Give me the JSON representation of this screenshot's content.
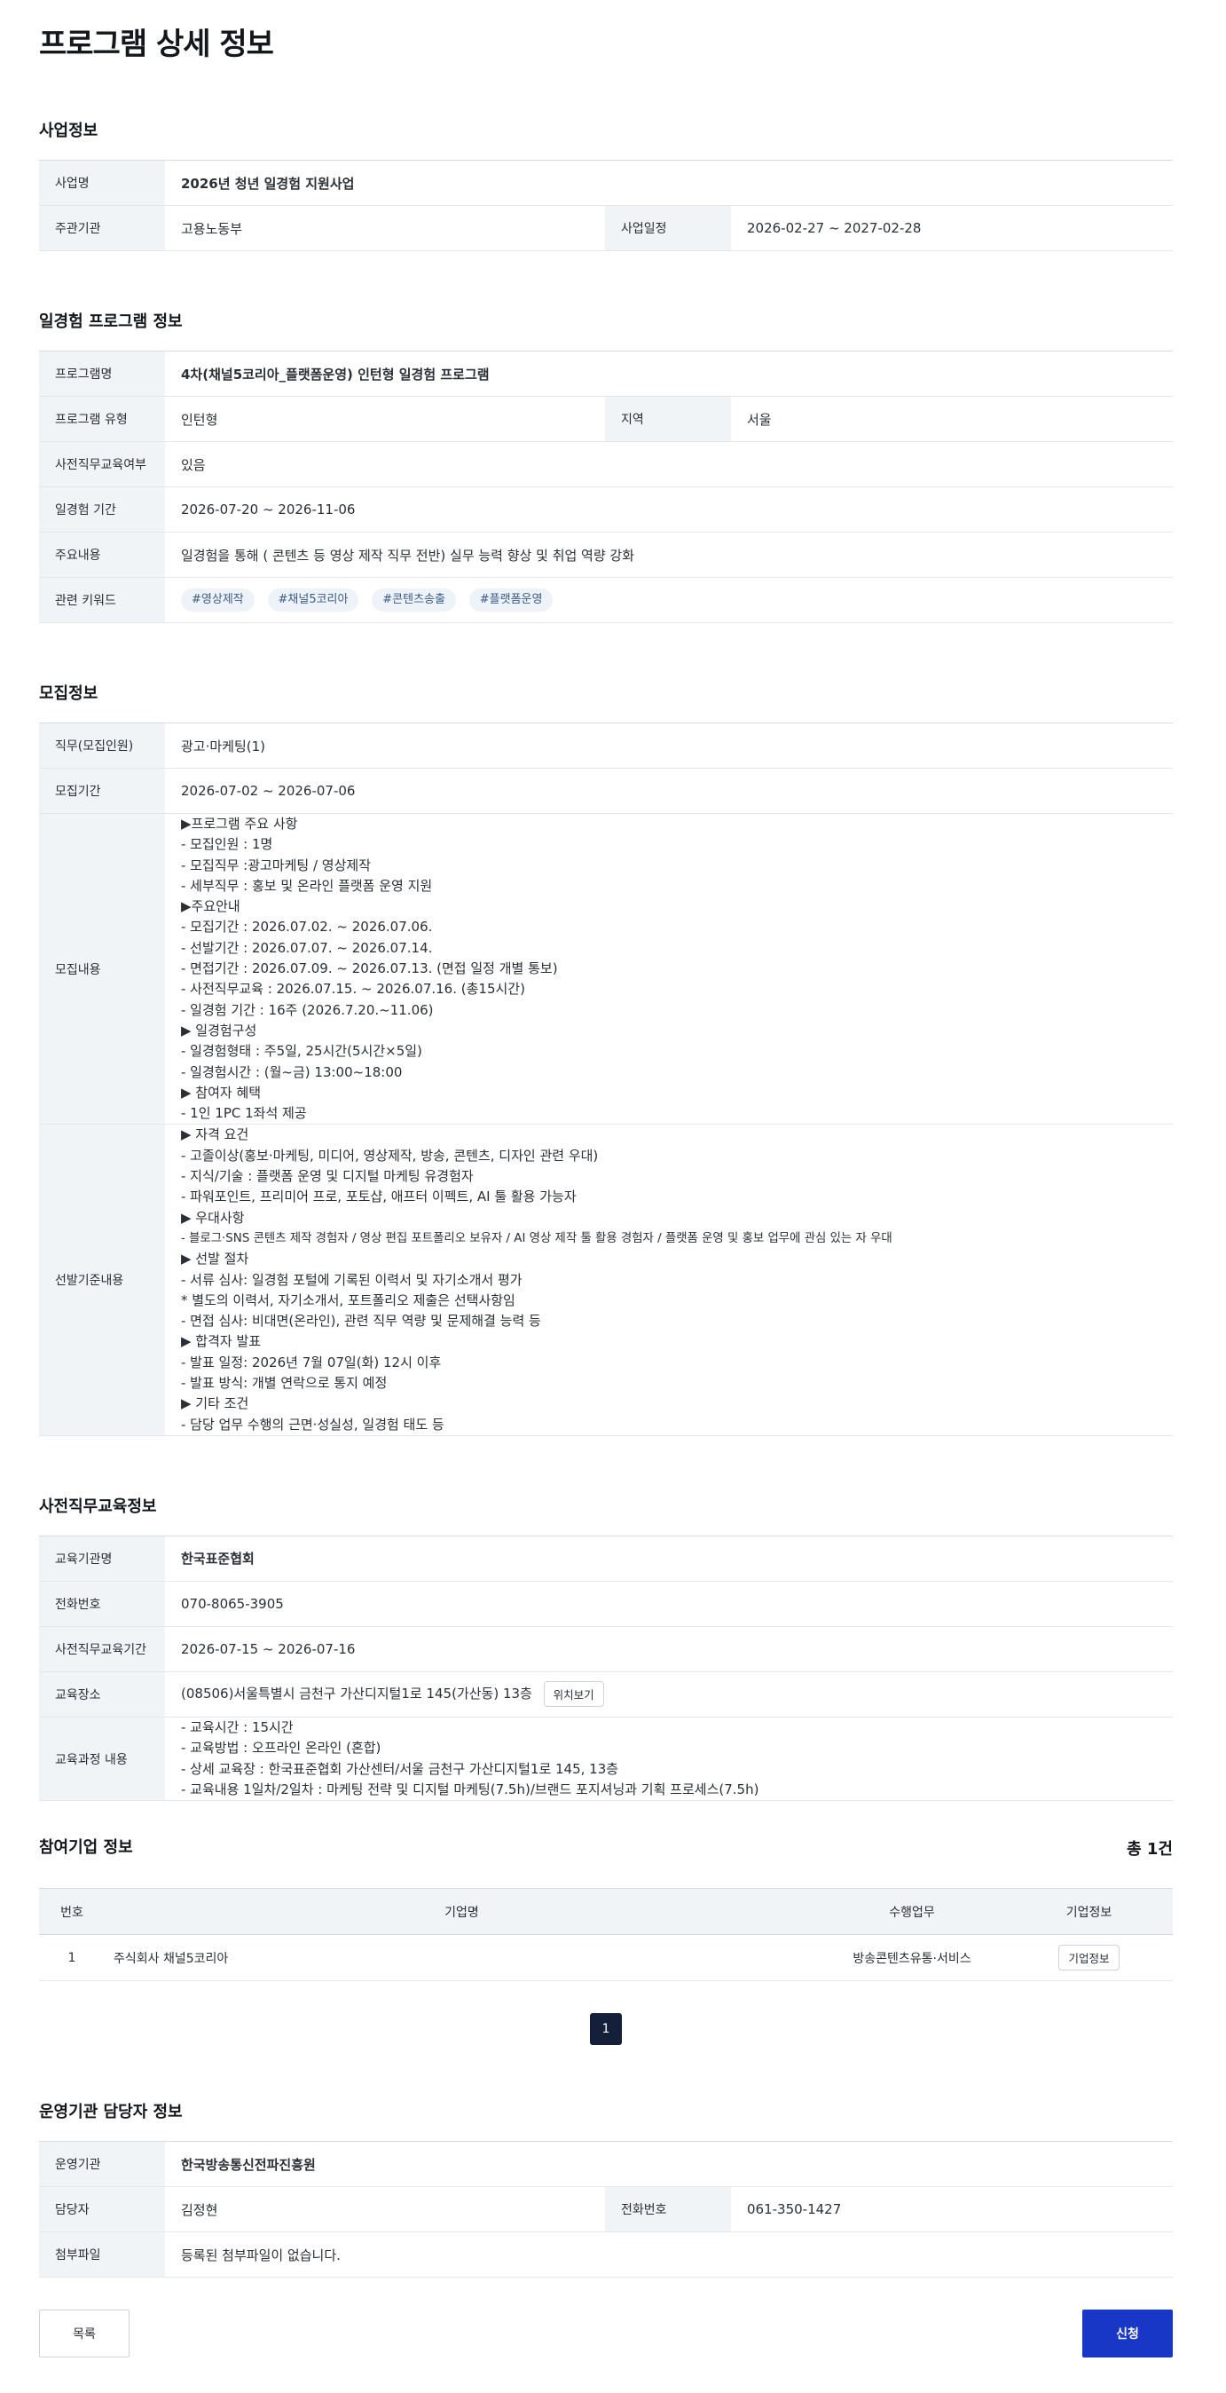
{
  "page_title": "프로그램 상세 정보",
  "business": {
    "title": "사업정보",
    "name_label": "사업명",
    "name": "2026년 청년 일경험 지원사업",
    "org_label": "주관기관",
    "org": "고용노동부",
    "period_label": "사업일정",
    "period": "2026-02-27 ~ 2027-02-28"
  },
  "program": {
    "title": "일경험 프로그램 정보",
    "name_label": "프로그램명",
    "name": "4차(채널5코리아_플랫폼운영) 인턴형 일경험 프로그램",
    "type_label": "프로그램 유형",
    "type": "인턴형",
    "region_label": "지역",
    "region": "서울",
    "pretraining_label": "사전직무교육여부",
    "pretraining": "있음",
    "period_label": "일경험 기간",
    "period": "2026-07-20 ~ 2026-11-06",
    "content_label": "주요내용",
    "content": "일경험을 통해 ( 콘텐츠 등 영상 제작 직무 전반) 실무 능력 향상 및 취업 역량 강화",
    "keywords_label": "관련 키워드",
    "keywords": [
      "#영상제작",
      "#채널5코리아",
      "#콘텐츠송출",
      "#플랫폼운영"
    ]
  },
  "recruit": {
    "title": "모집정보",
    "job_label": "직무(모집인원)",
    "job": "광고·마케팅(1)",
    "period_label": "모집기간",
    "period": "2026-07-02 ~ 2026-07-06",
    "content_label": "모집내용",
    "content_lines": [
      "▶프로그램 주요 사항",
      "- 모집인원 : 1명",
      "- 모집직무 :광고마케팅 / 영상제작",
      "- 세부직무 : 홍보 및 온라인 플랫폼 운영 지원",
      "▶주요안내",
      "- 모집기간 : 2026.07.02. ~ 2026.07.06.",
      "- 선발기간 : 2026.07.07. ~ 2026.07.14.",
      "- 면접기간 : 2026.07.09. ~ 2026.07.13. (면접 일정 개별 통보)",
      "- 사전직무교육 : 2026.07.15. ~ 2026.07.16. (총15시간)",
      "- 일경험 기간 : 16주 (2026.7.20.~11.06)",
      "▶ 일경험구성",
      "- 일경험형태 : 주5일, 25시간(5시간×5일)",
      "- 일경험시간 : (월~금) 13:00~18:00",
      "▶ 참여자 혜택",
      "- 1인 1PC 1좌석 제공"
    ],
    "criteria_label": "선발기준내용",
    "criteria_lines": [
      "▶ 자격 요건",
      "- 고졸이상(홍보·마케팅, 미디어, 영상제작, 방송, 콘텐츠, 디자인 관련 우대)",
      "- 지식/기술 : 플랫폼 운영 및 디지털 마케팅 유경험자",
      "- 파워포인트, 프리미어 프로, 포토샵, 애프터 이펙트, AI 툴 활용 가능자",
      "▶ 우대사항",
      "- 블로그·SNS 콘텐츠 제작 경험자 / 영상 편집 포트폴리오 보유자 / AI 영상 제작 툴 활용 경험자 / 플랫폼 운영 및 홍보 업무에 관심 있는 자 우대",
      "▶ 선발 절차",
      "- 서류 심사: 일경험 포털에 기록된 이력서 및 자기소개서 평가",
      "* 별도의 이력서, 자기소개서, 포트폴리오 제출은 선택사항임",
      "- 면접 심사: 비대면(온라인), 관련 직무 역량 및 문제해결 능력 등",
      "▶ 합격자 발표",
      "- 발표 일정: 2026년 7월 07일(화) 12시 이후",
      "- 발표 방식: 개별 연락으로 통지 예정",
      "▶ 기타 조건",
      "- 담당 업무 수행의 근면·성실성, 일경험 태도 등"
    ]
  },
  "education": {
    "title": "사전직무교육정보",
    "org_label": "교육기관명",
    "org": "한국표준협회",
    "phone_label": "전화번호",
    "phone": "070-8065-3905",
    "period_label": "사전직무교육기간",
    "period": "2026-07-15 ~ 2026-07-16",
    "place_label": "교육장소",
    "place": "(08506)서울특별시 금천구 가산디지털1로 145(가산동) 13층",
    "map_button": "위치보기",
    "course_label": "교육과정 내용",
    "course_lines": [
      "- 교육시간 : 15시간",
      "- 교육방법 : 오프라인 온라인 (혼합)",
      "- 상세 교육장 : 한국표준협회 가산센터/서울 금천구 가산디지털1로 145, 13층",
      "- 교육내용 1일차/2일차 : 마케팅 전략 및 디지털 마케팅(7.5h)/브랜드 포지셔닝과 기획 프로세스(7.5h)"
    ]
  },
  "companies": {
    "title": "참여기업 정보",
    "total": "총 1건",
    "headers": [
      "번호",
      "기업명",
      "수행업무",
      "기업정보"
    ],
    "rows": [
      {
        "no": "1",
        "name": "주식회사 채널5코리아",
        "task": "방송콘텐츠유통·서비스",
        "button": "기업정보"
      }
    ],
    "current_page": "1"
  },
  "operator": {
    "title": "운영기관 담당자 정보",
    "org_label": "운영기관",
    "org": "한국방송통신전파진흥원",
    "manager_label": "담당자",
    "manager": "김정현",
    "phone_label": "전화번호",
    "phone": "061-350-1427",
    "file_label": "첨부파일",
    "file": "등록된 첨부파일이 없습니다."
  },
  "buttons": {
    "list": "목록",
    "apply": "신청"
  }
}
